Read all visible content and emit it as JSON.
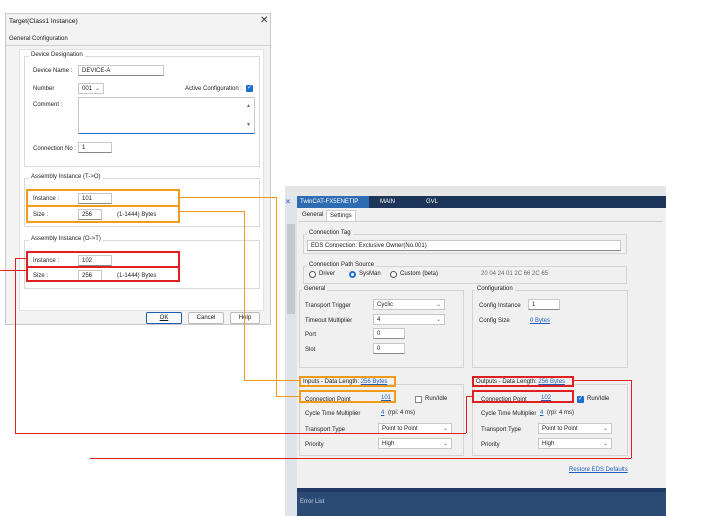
{
  "dialog": {
    "title": "Target(Class1 Instance)",
    "close_glyph": "✕",
    "tab": "General Configuration",
    "device_designation": {
      "group_label": "Device Designation",
      "device_name_label": "Device Name :",
      "device_name_value": "DEVICE-A",
      "number_label": "Number",
      "number_value": "001",
      "active_config_label": "Active Configuration :",
      "active_config_checked": "✓",
      "comment_label": "Comment :",
      "connection_no_label": "Connection No :",
      "connection_no_value": "1"
    },
    "assembly_to": {
      "group_label": "Assembly Instance (T->O)",
      "instance_label": "Instance :",
      "instance_value": "101",
      "size_label": "Size :",
      "size_value": "256",
      "size_range": "(1-1444) Bytes"
    },
    "assembly_ot": {
      "group_label": "Assembly Instance (O->T)",
      "instance_label": "Instance :",
      "instance_value": "102",
      "size_label": "Size :",
      "size_value": "256",
      "size_range": "(1-1444) Bytes"
    },
    "buttons": {
      "ok": "OK",
      "cancel": "Cancel",
      "help": "Help"
    }
  },
  "twincat": {
    "tabs": [
      {
        "label": "TwinCAT-FX5ENETIP",
        "pin": "⊕",
        "close": "✕"
      },
      {
        "label": "MAIN"
      },
      {
        "label": "GVL"
      }
    ],
    "side_close": "✕",
    "subtabs": [
      "General",
      "Settings"
    ],
    "connection_tag": {
      "group_label": "Connection Tag",
      "value": "EDS Connection: Exclusive Owner(No.001)"
    },
    "connection_path_source": {
      "group_label": "Connection Path Source",
      "options": [
        "Driver",
        "SysMan",
        "Custom (beta)"
      ],
      "selected": "SysMan",
      "path": "20 04 24 01 2C 66 2C 65"
    },
    "general": {
      "group_label": "General",
      "transport_trigger_label": "Transport Trigger",
      "transport_trigger_value": "Cyclic",
      "timeout_multiplier_label": "Timeout Multiplier",
      "timeout_multiplier_value": "4",
      "port_label": "Port",
      "port_value": "0",
      "slot_label": "Slot",
      "slot_value": "0"
    },
    "configuration": {
      "group_label": "Configuration",
      "config_instance_label": "Config Instance",
      "config_instance_value": "1",
      "config_size_label": "Config Size",
      "config_size_value": "0 Bytes"
    },
    "inputs": {
      "group_label": "Inputs - Data Length:",
      "group_link": "256 Bytes",
      "connection_point_label": "Connection Point",
      "connection_point_value": "101",
      "run_idle_label": "Run/Idle",
      "cycle_time_label": "Cycle Time Multiplier",
      "cycle_time_value": "4",
      "cycle_time_suffix": "(rpi: 4 ms)",
      "transport_type_label": "Transport Type",
      "transport_type_value": "Point to Point",
      "priority_label": "Priority",
      "priority_value": "High"
    },
    "outputs": {
      "group_label": "Outputs - Data Length:",
      "group_link": "256 Bytes",
      "connection_point_label": "Connection Point",
      "connection_point_value": "102",
      "run_idle_label": "Run/Idle",
      "run_idle_checked": "✓",
      "cycle_time_label": "Cycle Time Multiplier",
      "cycle_time_value": "4",
      "cycle_time_suffix": "(rpi: 4 ms)",
      "transport_type_label": "Transport Type",
      "transport_type_value": "Point to Point",
      "priority_label": "Priority",
      "priority_value": "High"
    },
    "restore_link": "Restore EDS Defaults",
    "bottom_panel_label": "Error List"
  },
  "colors": {
    "highlight_orange": "#f29b1b",
    "highlight_red": "#e02020",
    "accent_blue": "#1e6fd0",
    "tab_active": "#2d6bb3"
  }
}
